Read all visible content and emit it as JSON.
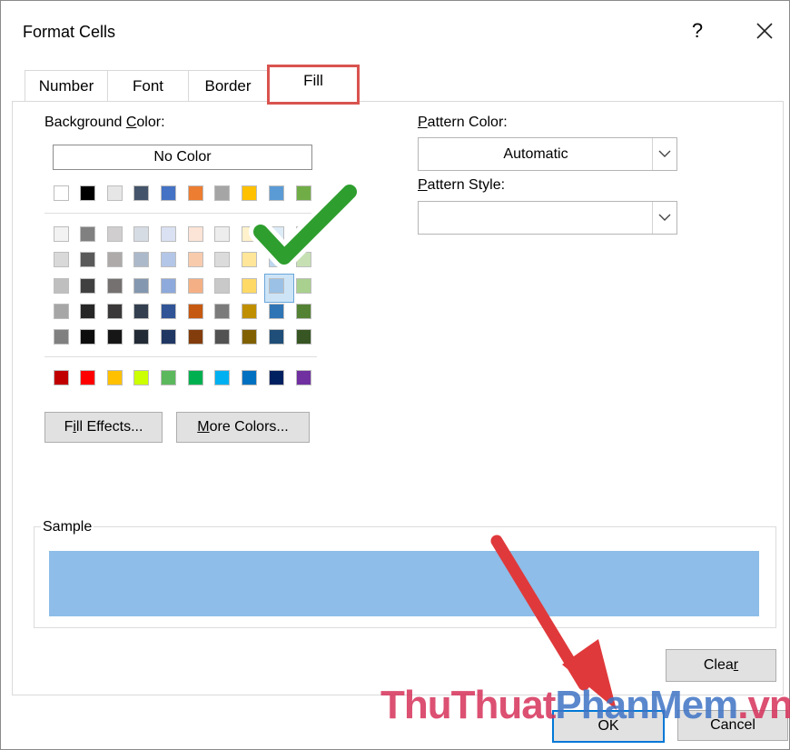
{
  "dialog": {
    "title": "Format Cells",
    "help_glyph": "?",
    "close_icon": "close-icon"
  },
  "tabs": [
    {
      "label": "Number"
    },
    {
      "label": "Font"
    },
    {
      "label": "Border"
    },
    {
      "label": "Fill",
      "selected": true
    }
  ],
  "background_color": {
    "label_pre": "Background ",
    "label_ul": "C",
    "label_post": "olor:",
    "no_color": "No Color",
    "selected_swatch": "#9dc3e6",
    "theme_row": [
      "#ffffff",
      "#000000",
      "#e7e6e6",
      "#44546a",
      "#4472c4",
      "#ed7d31",
      "#a5a5a5",
      "#ffc000",
      "#5b9bd5",
      "#70ad47"
    ],
    "tint_rows": [
      [
        "#f2f2f2",
        "#808080",
        "#d0cece",
        "#d6dce4",
        "#d9e1f2",
        "#fce4d6",
        "#ededed",
        "#fff2cc",
        "#ddebf7",
        "#e2efda"
      ],
      [
        "#d9d9d9",
        "#595959",
        "#aeaaaa",
        "#acb9ca",
        "#b4c6e7",
        "#f8cbad",
        "#dbdbdb",
        "#ffe699",
        "#bdd7ee",
        "#c6e0b4"
      ],
      [
        "#bfbfbf",
        "#404040",
        "#757171",
        "#8497b0",
        "#8ea9db",
        "#f4b084",
        "#c9c9c9",
        "#ffd966",
        "#9bc2e6",
        "#a9d08e"
      ],
      [
        "#a6a6a6",
        "#262626",
        "#3a3838",
        "#333f4f",
        "#305496",
        "#c65911",
        "#7b7b7b",
        "#bf8f00",
        "#2f75b5",
        "#548235"
      ],
      [
        "#808080",
        "#0d0d0d",
        "#161616",
        "#222b35",
        "#203764",
        "#833c0c",
        "#525252",
        "#806000",
        "#1f4e78",
        "#375623"
      ]
    ],
    "standard_row": [
      "#c00000",
      "#ff0000",
      "#ffc000",
      "#ccff00",
      "#5cb85c",
      "#00b050",
      "#00b0f0",
      "#0070c0",
      "#002060",
      "#7030a0"
    ]
  },
  "buttons": {
    "fill_effects_pre": "F",
    "fill_effects_ul": "i",
    "fill_effects_post": "ll Effects...",
    "more_colors_pre": "",
    "more_colors_ul": "M",
    "more_colors_post": "ore Colors...",
    "clear_pre": "Clea",
    "clear_ul": "r",
    "clear_post": "",
    "ok": "OK",
    "cancel": "Cancel"
  },
  "pattern_color": {
    "label_ul": "P",
    "label_post": "attern Color:",
    "value": "Automatic"
  },
  "pattern_style": {
    "label_ul": "P",
    "label_post": "attern Style:",
    "value": ""
  },
  "sample": {
    "legend": "Sample",
    "fill_color": "#8dbde8"
  },
  "overlay": {
    "watermark_a": "ThuThuat",
    "watermark_b": "PhanMem",
    "watermark_c": ".vn",
    "checkmark_icon": "green-checkmark-icon",
    "arrow_icon": "red-arrow-icon"
  }
}
